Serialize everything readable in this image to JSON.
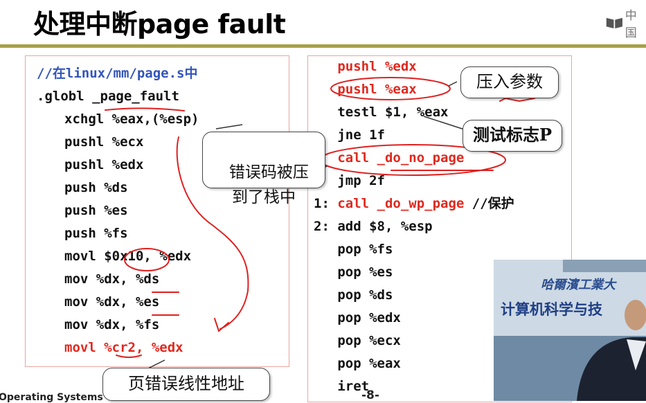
{
  "header": {
    "title": "处理中断page fault",
    "logo_text": "中国"
  },
  "left_code": [
    {
      "text": "//在linux/mm/page.s中",
      "indent": 0,
      "style": "comment"
    },
    {
      "text": ".globl _page_fault",
      "indent": 0,
      "style": "normal"
    },
    {
      "text": "xchgl %eax,(%esp)",
      "indent": 1,
      "style": "normal"
    },
    {
      "text": "pushl %ecx",
      "indent": 1,
      "style": "normal"
    },
    {
      "text": "pushl %edx",
      "indent": 1,
      "style": "normal"
    },
    {
      "text": "push %ds",
      "indent": 1,
      "style": "normal"
    },
    {
      "text": "push %es",
      "indent": 1,
      "style": "normal"
    },
    {
      "text": "push %fs",
      "indent": 1,
      "style": "normal"
    },
    {
      "text": "movl $0x10, %edx",
      "indent": 1,
      "style": "normal"
    },
    {
      "text": "mov %dx, %ds",
      "indent": 1,
      "style": "normal"
    },
    {
      "text": "mov %dx, %es",
      "indent": 1,
      "style": "normal"
    },
    {
      "text": "mov %dx, %fs",
      "indent": 1,
      "style": "normal"
    },
    {
      "text": "movl %cr2, %edx",
      "indent": 1,
      "style": "red"
    }
  ],
  "right_code": [
    {
      "text": "   pushl %edx",
      "style": "red"
    },
    {
      "text": "   pushl %eax",
      "style": "red"
    },
    {
      "text": "   testl $1, %eax",
      "style": "normal"
    },
    {
      "text": "   jne 1f",
      "style": "normal"
    },
    {
      "text": "   call _do_no_page",
      "style": "red"
    },
    {
      "text": "   jmp 2f",
      "style": "normal"
    },
    {
      "text": "1: call _do_wp_page //保护",
      "style": "mixed"
    },
    {
      "text": "2: add $8, %esp",
      "style": "normal"
    },
    {
      "text": "   pop %fs",
      "style": "normal"
    },
    {
      "text": "   pop %es",
      "style": "normal"
    },
    {
      "text": "   pop %ds",
      "style": "normal"
    },
    {
      "text": "   pop %edx",
      "style": "normal"
    },
    {
      "text": "   pop %ecx",
      "style": "normal"
    },
    {
      "text": "   pop %eax",
      "style": "normal"
    },
    {
      "text": "   iret",
      "style": "normal"
    }
  ],
  "wp_line": {
    "prefix": "1: ",
    "call": "call _do_wp_page",
    "comment": " //保护"
  },
  "callouts": {
    "error_code": "错误码被压\n到了栈中",
    "push_params": "压入参数",
    "test_flag": "测试标志P",
    "linear_addr": "页错误线性地址"
  },
  "footer": {
    "page_number": "-8-",
    "course": "Operating Systems"
  },
  "video": {
    "sign_line1": "哈爾濱工業大",
    "sign_line2": "计算机科学与技"
  },
  "colors": {
    "rule": "#a7a04a",
    "code_red": "#e0291f",
    "comment_blue": "#3355bb",
    "box_border": "#e8a6a0",
    "ink_red": "#e02020"
  }
}
